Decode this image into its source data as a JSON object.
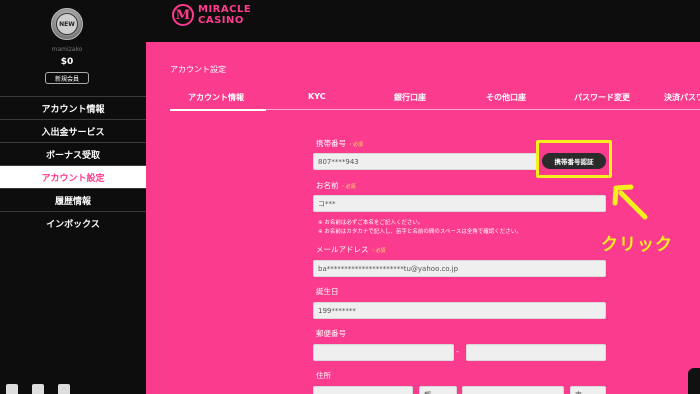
{
  "sidebar": {
    "avatar_text": "NEW",
    "username": "mamizako",
    "balance": "$0",
    "member_badge": "新規会員",
    "menu": [
      {
        "label": "アカウント情報",
        "active": false
      },
      {
        "label": "入出金サービス",
        "active": false
      },
      {
        "label": "ボーナス受取",
        "active": false
      },
      {
        "label": "アカウント設定",
        "active": true
      },
      {
        "label": "履歴情報",
        "active": false
      },
      {
        "label": "インボックス",
        "active": false
      }
    ]
  },
  "header": {
    "logo_mark": "M",
    "logo_line1": "MIRACLE",
    "logo_line2": "CASINO"
  },
  "main": {
    "section_title": "アカウント設定",
    "tabs": [
      "アカウント情報",
      "KYC",
      "銀行口座",
      "その他口座",
      "パスワード変更",
      "決済パスワ"
    ]
  },
  "form": {
    "phone_label": "携帯番号",
    "required_mark": "・必須",
    "phone_value": "807****943",
    "verify_button": "携帯番号認証",
    "name_label": "お名前",
    "name_value": "コ***",
    "note1": "※ お名前は必ずご本名をご記入ください。",
    "note2": "※ お名前はカタカナで記入し、苗字と名前の間のスペースは全角で確認ください。",
    "email_label": "メールアドレス",
    "email_value": "ba**********************tu@yahoo.co.jp",
    "birthday_label": "誕生日",
    "birthday_value": "199*******",
    "postal_label": "郵便番号",
    "postal_value1": "",
    "postal_value2": "",
    "postal_separator": "-",
    "address_label": "住所",
    "address_suffix1": "都",
    "address_suffix2": "市"
  },
  "annotation": {
    "click_text": "クリック",
    "color": "#f5f01e"
  },
  "colors": {
    "accent_pink": "#fb3b8e",
    "sidebar_bg": "#0d0d0d",
    "highlight": "#f5f01e"
  }
}
